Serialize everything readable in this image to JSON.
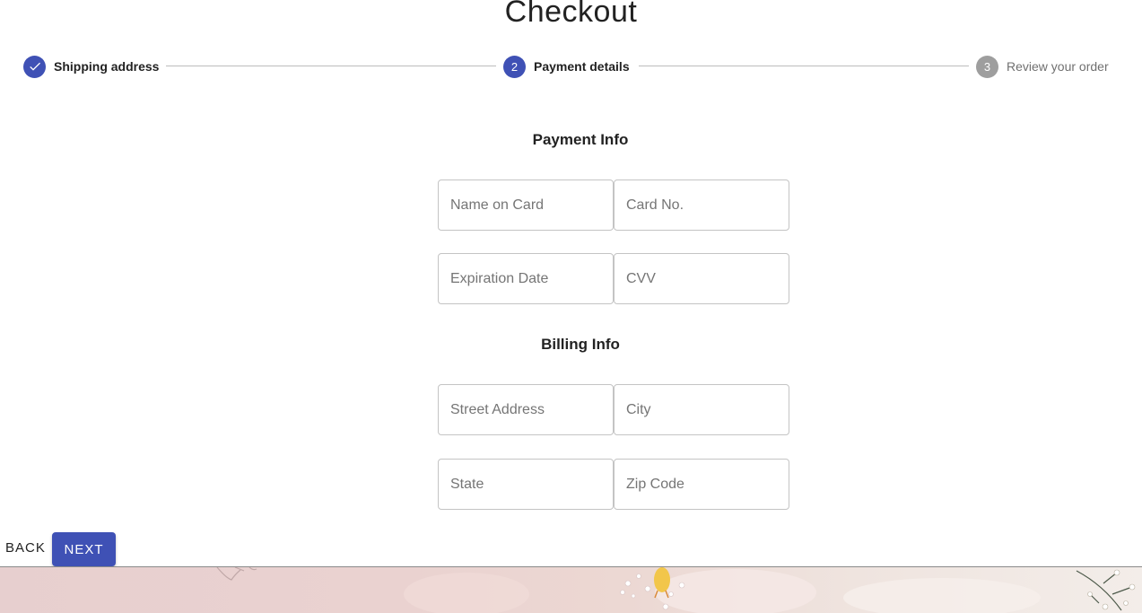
{
  "page": {
    "title": "Checkout"
  },
  "stepper": {
    "steps": [
      {
        "label": "Shipping address",
        "state": "completed",
        "icon": "check-icon"
      },
      {
        "number": "2",
        "label": "Payment details",
        "state": "active"
      },
      {
        "number": "3",
        "label": "Review your order",
        "state": "pending"
      }
    ]
  },
  "payment": {
    "heading": "Payment Info",
    "fields": {
      "name_on_card": {
        "placeholder": "Name on Card",
        "value": ""
      },
      "card_no": {
        "placeholder": "Card No.",
        "value": ""
      },
      "expiration_date": {
        "placeholder": "Expiration Date",
        "value": ""
      },
      "cvv": {
        "placeholder": "CVV",
        "value": ""
      }
    }
  },
  "billing": {
    "heading": "Billing Info",
    "fields": {
      "street_address": {
        "placeholder": "Street Address",
        "value": ""
      },
      "city": {
        "placeholder": "City",
        "value": ""
      },
      "state": {
        "placeholder": "State",
        "value": ""
      },
      "zip_code": {
        "placeholder": "Zip Code",
        "value": ""
      }
    }
  },
  "actions": {
    "back_label": "BACK",
    "next_label": "NEXT"
  },
  "colors": {
    "accent": "#3f51b5",
    "pending": "#9e9e9e",
    "connector": "#bdbdbd",
    "banner": "#e9d2d0"
  }
}
